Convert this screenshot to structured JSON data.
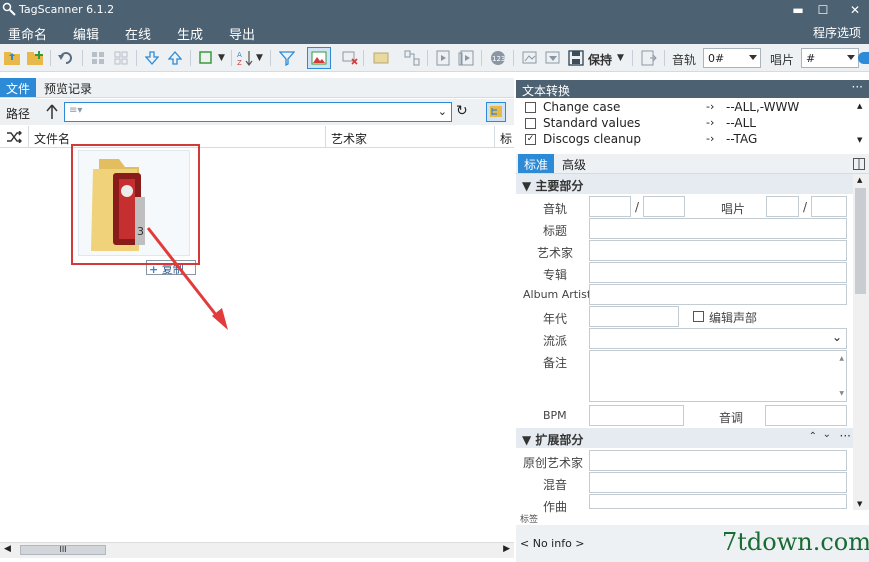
{
  "window": {
    "title": "TagScanner 6.1.2",
    "minimize": "▬",
    "maximize": "☐",
    "close": "✕"
  },
  "menu": {
    "items": [
      "重命名",
      "编辑",
      "在线",
      "生成",
      "导出"
    ],
    "active_index": 1,
    "options": "程序选项"
  },
  "toolbar": {
    "save_label": "保持",
    "track_label": "音轨",
    "track_value": "0#",
    "disc_label": "唱片",
    "disc_value": "#"
  },
  "left": {
    "tabs": [
      "文件",
      "预览记录"
    ],
    "path_label": "路径",
    "path_value": "≡▾",
    "columns": [
      "文件名",
      "艺术家",
      "标"
    ],
    "drag_tooltip": "复制",
    "hscroll_thumb": "III"
  },
  "right": {
    "conv_title": "文本转换",
    "conversions": [
      {
        "name": "Change case",
        "value": "--ALL,-WWW",
        "checked": false
      },
      {
        "name": "Standard values",
        "value": "--ALL",
        "checked": false
      },
      {
        "name": "Discogs cleanup",
        "value": "--TAG",
        "checked": true
      }
    ],
    "tabs": [
      "标准",
      "高级"
    ],
    "main_group": "主要部分",
    "ext_group": "扩展部分",
    "fields": {
      "track": "音轨",
      "disc": "唱片",
      "title": "标题",
      "artist": "艺术家",
      "album": "专辑",
      "album_artist": "Album Artist",
      "year": "年代",
      "edit_voice": "编辑声部",
      "genre": "流派",
      "comment": "备注",
      "bpm": "BPM",
      "key": "音调",
      "orig_artist": "原创艺术家",
      "remix": "混音",
      "composer": "作曲",
      "slash": "/"
    },
    "footer_label": "标签",
    "no_info": "< No info >"
  },
  "watermark": "7tdown.com",
  "colors": {
    "titlebar": "#4c6172",
    "accent": "#2d8ad6",
    "highlight_box": "#d23a3a",
    "arrow": "#e23b3b",
    "watermark": "#1a6b33"
  }
}
